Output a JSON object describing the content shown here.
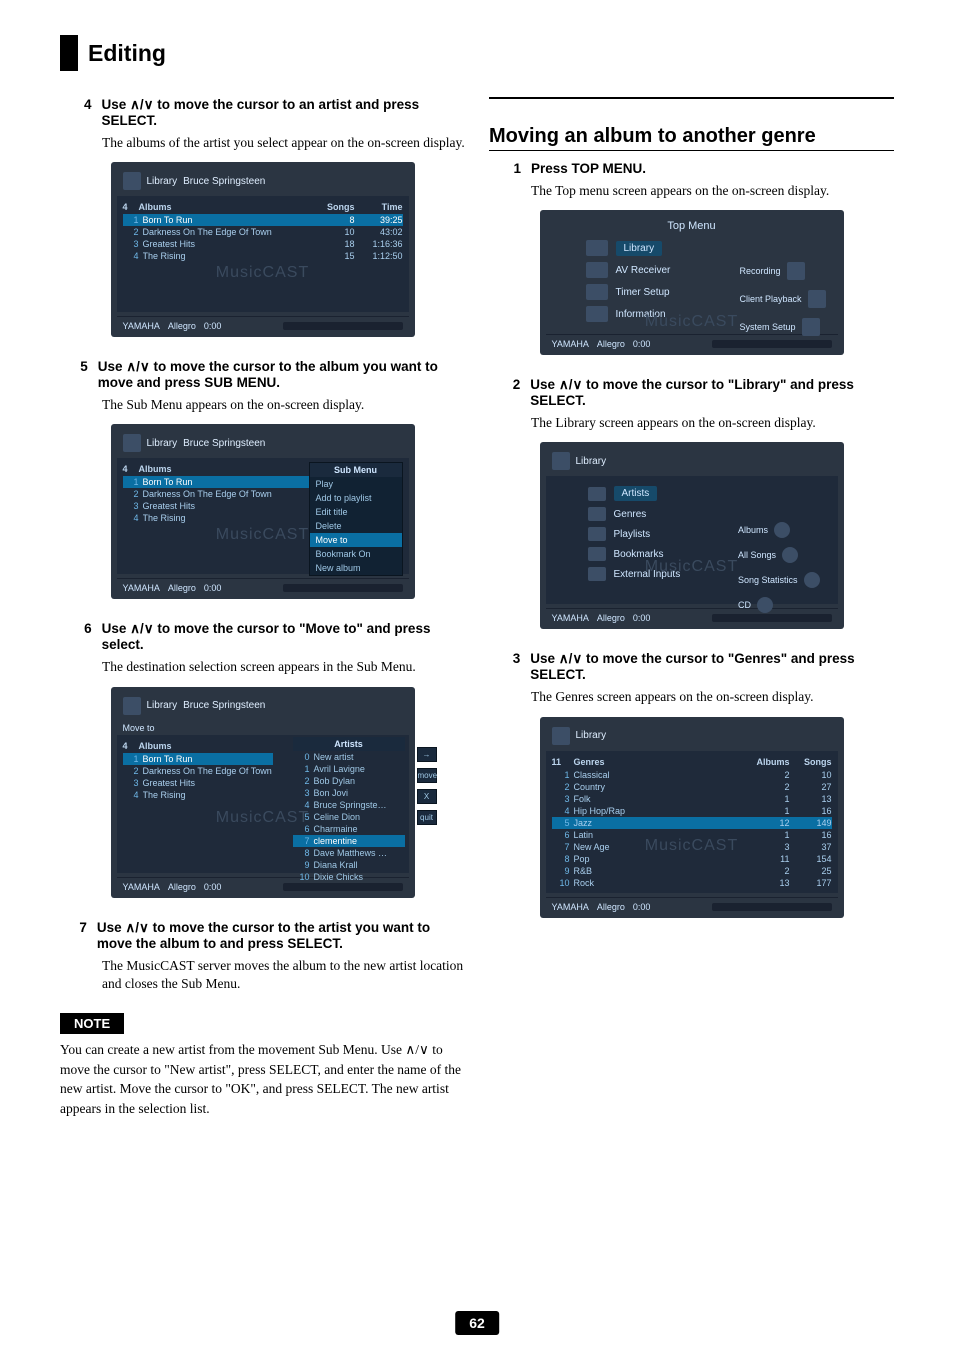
{
  "page": {
    "title": "Editing",
    "number": "62"
  },
  "left": {
    "s4": {
      "num": "4",
      "inst": "Use ∧/∨ to move the cursor to an artist and press SELECT.",
      "body": "The albums of the artist you select appear on the on-screen display."
    },
    "s5": {
      "num": "5",
      "inst": "Use ∧/∨ to move the cursor to the album you want to move and press SUB MENU.",
      "body": "The Sub Menu appears on the on-screen display."
    },
    "s6": {
      "num": "6",
      "inst": "Use ∧/∨ to move the cursor to \"Move to\" and press select.",
      "body": "The destination selection screen appears in the Sub Menu."
    },
    "s7": {
      "num": "7",
      "inst": "Use ∧/∨ to move the cursor to the artist you want to move the album to and press SELECT.",
      "body": "The MusicCAST server moves the album to the new artist location and closes the Sub Menu."
    },
    "noteTitle": "NOTE",
    "note": "You can create a new artist from the movement Sub Menu. Use ∧/∨ to move the cursor to \"New artist\", press SELECT, and enter the name of the new artist. Move the cursor to \"OK\", and press SELECT. The new artist appears in the selection list."
  },
  "right": {
    "h2": "Moving an album to another genre",
    "s1": {
      "num": "1",
      "inst": "Press TOP MENU.",
      "body": "The Top menu screen appears on the on-screen display."
    },
    "s2": {
      "num": "2",
      "inst": "Use ∧/∨ to move the cursor to \"Library\" and press SELECT.",
      "body": "The Library screen appears on the on-screen display."
    },
    "s3": {
      "num": "3",
      "inst": "Use ∧/∨ to move the cursor to \"Genres\" and press SELECT.",
      "body": "The Genres screen appears on the on-screen display."
    }
  },
  "screens": {
    "common": {
      "brand": "YAMAHA",
      "track": "Allegro",
      "time": "0:00",
      "watermark": "MusicCAST"
    },
    "albums": {
      "crumb1": "Library",
      "crumb2": "Bruce Springsteen",
      "count": "4",
      "hdr_albums": "Albums",
      "hdr_songs": "Songs",
      "hdr_time": "Time",
      "rows": [
        {
          "n": "1",
          "t": "Born To Run",
          "s": "8",
          "tm": "39:25"
        },
        {
          "n": "2",
          "t": "Darkness On The Edge Of Town",
          "s": "10",
          "tm": "43:02"
        },
        {
          "n": "3",
          "t": "Greatest Hits",
          "s": "18",
          "tm": "1:16:36"
        },
        {
          "n": "4",
          "t": "The Rising",
          "s": "15",
          "tm": "1:12:50"
        }
      ]
    },
    "submenu": {
      "title": "Sub Menu",
      "items": [
        "Play",
        "Add to playlist",
        "Edit title",
        "Delete",
        "Move to",
        "Bookmark On",
        "New album"
      ],
      "hl": "Move to"
    },
    "moveto": {
      "label": "Move to",
      "artists_title": "Artists",
      "artists": [
        {
          "n": "0",
          "t": "New artist"
        },
        {
          "n": "1",
          "t": "Avril Lavigne"
        },
        {
          "n": "2",
          "t": "Bob Dylan"
        },
        {
          "n": "3",
          "t": "Bon Jovi"
        },
        {
          "n": "4",
          "t": "Bruce Springste…"
        },
        {
          "n": "5",
          "t": "Celine Dion"
        },
        {
          "n": "6",
          "t": "Charmaine"
        },
        {
          "n": "7",
          "t": "clementine"
        },
        {
          "n": "8",
          "t": "Dave Matthews …"
        },
        {
          "n": "9",
          "t": "Diana Krall"
        },
        {
          "n": "10",
          "t": "Dixie Chicks"
        }
      ],
      "side": [
        "→",
        "move",
        "X",
        "quit"
      ]
    },
    "topmenu": {
      "title": "Top Menu",
      "left": [
        "Library",
        "AV Receiver",
        "Timer Setup",
        "Information"
      ],
      "right": [
        "Recording",
        "Client Playback",
        "System Setup"
      ]
    },
    "library": {
      "title": "Library",
      "left": [
        "Artists",
        "Genres",
        "Playlists",
        "Bookmarks",
        "External Inputs"
      ],
      "right": [
        "Albums",
        "All Songs",
        "Song Statistics",
        "CD"
      ]
    },
    "genres": {
      "crumb": "Library",
      "count": "11",
      "hdr_g": "Genres",
      "hdr_a": "Albums",
      "hdr_s": "Songs",
      "rows": [
        {
          "n": "1",
          "t": "Classical",
          "a": "2",
          "s": "10"
        },
        {
          "n": "2",
          "t": "Country",
          "a": "2",
          "s": "27"
        },
        {
          "n": "3",
          "t": "Folk",
          "a": "1",
          "s": "13"
        },
        {
          "n": "4",
          "t": "Hip Hop/Rap",
          "a": "1",
          "s": "16"
        },
        {
          "n": "5",
          "t": "Jazz",
          "a": "12",
          "s": "149"
        },
        {
          "n": "6",
          "t": "Latin",
          "a": "1",
          "s": "16"
        },
        {
          "n": "7",
          "t": "New Age",
          "a": "3",
          "s": "37"
        },
        {
          "n": "8",
          "t": "Pop",
          "a": "11",
          "s": "154"
        },
        {
          "n": "9",
          "t": "R&B",
          "a": "2",
          "s": "25"
        },
        {
          "n": "10",
          "t": "Rock",
          "a": "13",
          "s": "177"
        }
      ]
    }
  }
}
